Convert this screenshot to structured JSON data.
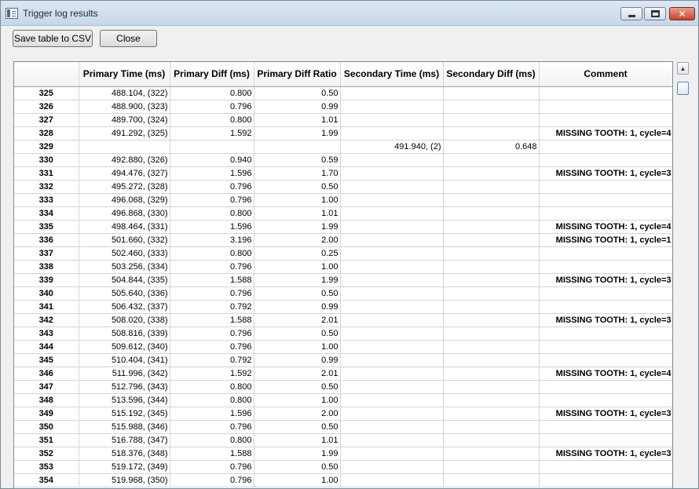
{
  "window": {
    "title": "Trigger log results"
  },
  "toolbar": {
    "save_label": "Save table to CSV",
    "close_label": "Close"
  },
  "table": {
    "headers": [
      "",
      "Primary Time (ms)",
      "Primary Diff (ms)",
      "Primary Diff Ratio",
      "Secondary Time (ms)",
      "Secondary Diff (ms)",
      "Comment"
    ],
    "rows": [
      [
        "325",
        "488.104, (322)",
        "0.800",
        "0.50",
        "",
        "",
        ""
      ],
      [
        "326",
        "488.900, (323)",
        "0.796",
        "0.99",
        "",
        "",
        ""
      ],
      [
        "327",
        "489.700, (324)",
        "0.800",
        "1.01",
        "",
        "",
        ""
      ],
      [
        "328",
        "491.292, (325)",
        "1.592",
        "1.99",
        "",
        "",
        "MISSING TOOTH: 1, cycle=4"
      ],
      [
        "329",
        "",
        "",
        "",
        "491.940, (2)",
        "0.648",
        ""
      ],
      [
        "330",
        "492.880, (326)",
        "0.940",
        "0.59",
        "",
        "",
        ""
      ],
      [
        "331",
        "494.476, (327)",
        "1.596",
        "1.70",
        "",
        "",
        "MISSING TOOTH: 1, cycle=3"
      ],
      [
        "332",
        "495.272, (328)",
        "0.796",
        "0.50",
        "",
        "",
        ""
      ],
      [
        "333",
        "496.068, (329)",
        "0.796",
        "1.00",
        "",
        "",
        ""
      ],
      [
        "334",
        "496.868, (330)",
        "0.800",
        "1.01",
        "",
        "",
        ""
      ],
      [
        "335",
        "498.464, (331)",
        "1.596",
        "1.99",
        "",
        "",
        "MISSING TOOTH: 1, cycle=4"
      ],
      [
        "336",
        "501.660, (332)",
        "3.196",
        "2.00",
        "",
        "",
        "MISSING TOOTH: 1, cycle=1"
      ],
      [
        "337",
        "502.460, (333)",
        "0.800",
        "0.25",
        "",
        "",
        ""
      ],
      [
        "338",
        "503.256, (334)",
        "0.796",
        "1.00",
        "",
        "",
        ""
      ],
      [
        "339",
        "504.844, (335)",
        "1.588",
        "1.99",
        "",
        "",
        "MISSING TOOTH: 1, cycle=3"
      ],
      [
        "340",
        "505.640, (336)",
        "0.796",
        "0.50",
        "",
        "",
        ""
      ],
      [
        "341",
        "506.432, (337)",
        "0.792",
        "0.99",
        "",
        "",
        ""
      ],
      [
        "342",
        "508.020, (338)",
        "1.588",
        "2.01",
        "",
        "",
        "MISSING TOOTH: 1, cycle=3"
      ],
      [
        "343",
        "508.816, (339)",
        "0.796",
        "0.50",
        "",
        "",
        ""
      ],
      [
        "344",
        "509.612, (340)",
        "0.796",
        "1.00",
        "",
        "",
        ""
      ],
      [
        "345",
        "510.404, (341)",
        "0.792",
        "0.99",
        "",
        "",
        ""
      ],
      [
        "346",
        "511.996, (342)",
        "1.592",
        "2.01",
        "",
        "",
        "MISSING TOOTH: 1, cycle=4"
      ],
      [
        "347",
        "512.796, (343)",
        "0.800",
        "0.50",
        "",
        "",
        ""
      ],
      [
        "348",
        "513.596, (344)",
        "0.800",
        "1.00",
        "",
        "",
        ""
      ],
      [
        "349",
        "515.192, (345)",
        "1.596",
        "2.00",
        "",
        "",
        "MISSING TOOTH: 1, cycle=3"
      ],
      [
        "350",
        "515.988, (346)",
        "0.796",
        "0.50",
        "",
        "",
        ""
      ],
      [
        "351",
        "516.788, (347)",
        "0.800",
        "1.01",
        "",
        "",
        ""
      ],
      [
        "352",
        "518.376, (348)",
        "1.588",
        "1.99",
        "",
        "",
        "MISSING TOOTH: 1, cycle=3"
      ],
      [
        "353",
        "519.172, (349)",
        "0.796",
        "0.50",
        "",
        "",
        ""
      ],
      [
        "354",
        "519.968, (350)",
        "0.796",
        "1.00",
        "",
        "",
        ""
      ]
    ]
  },
  "icons": {
    "app": "table-window-icon",
    "minimize": "minimize-icon",
    "maximize": "maximize-icon",
    "close": "close-icon",
    "scroll_up": "scroll-up-arrow-icon"
  }
}
